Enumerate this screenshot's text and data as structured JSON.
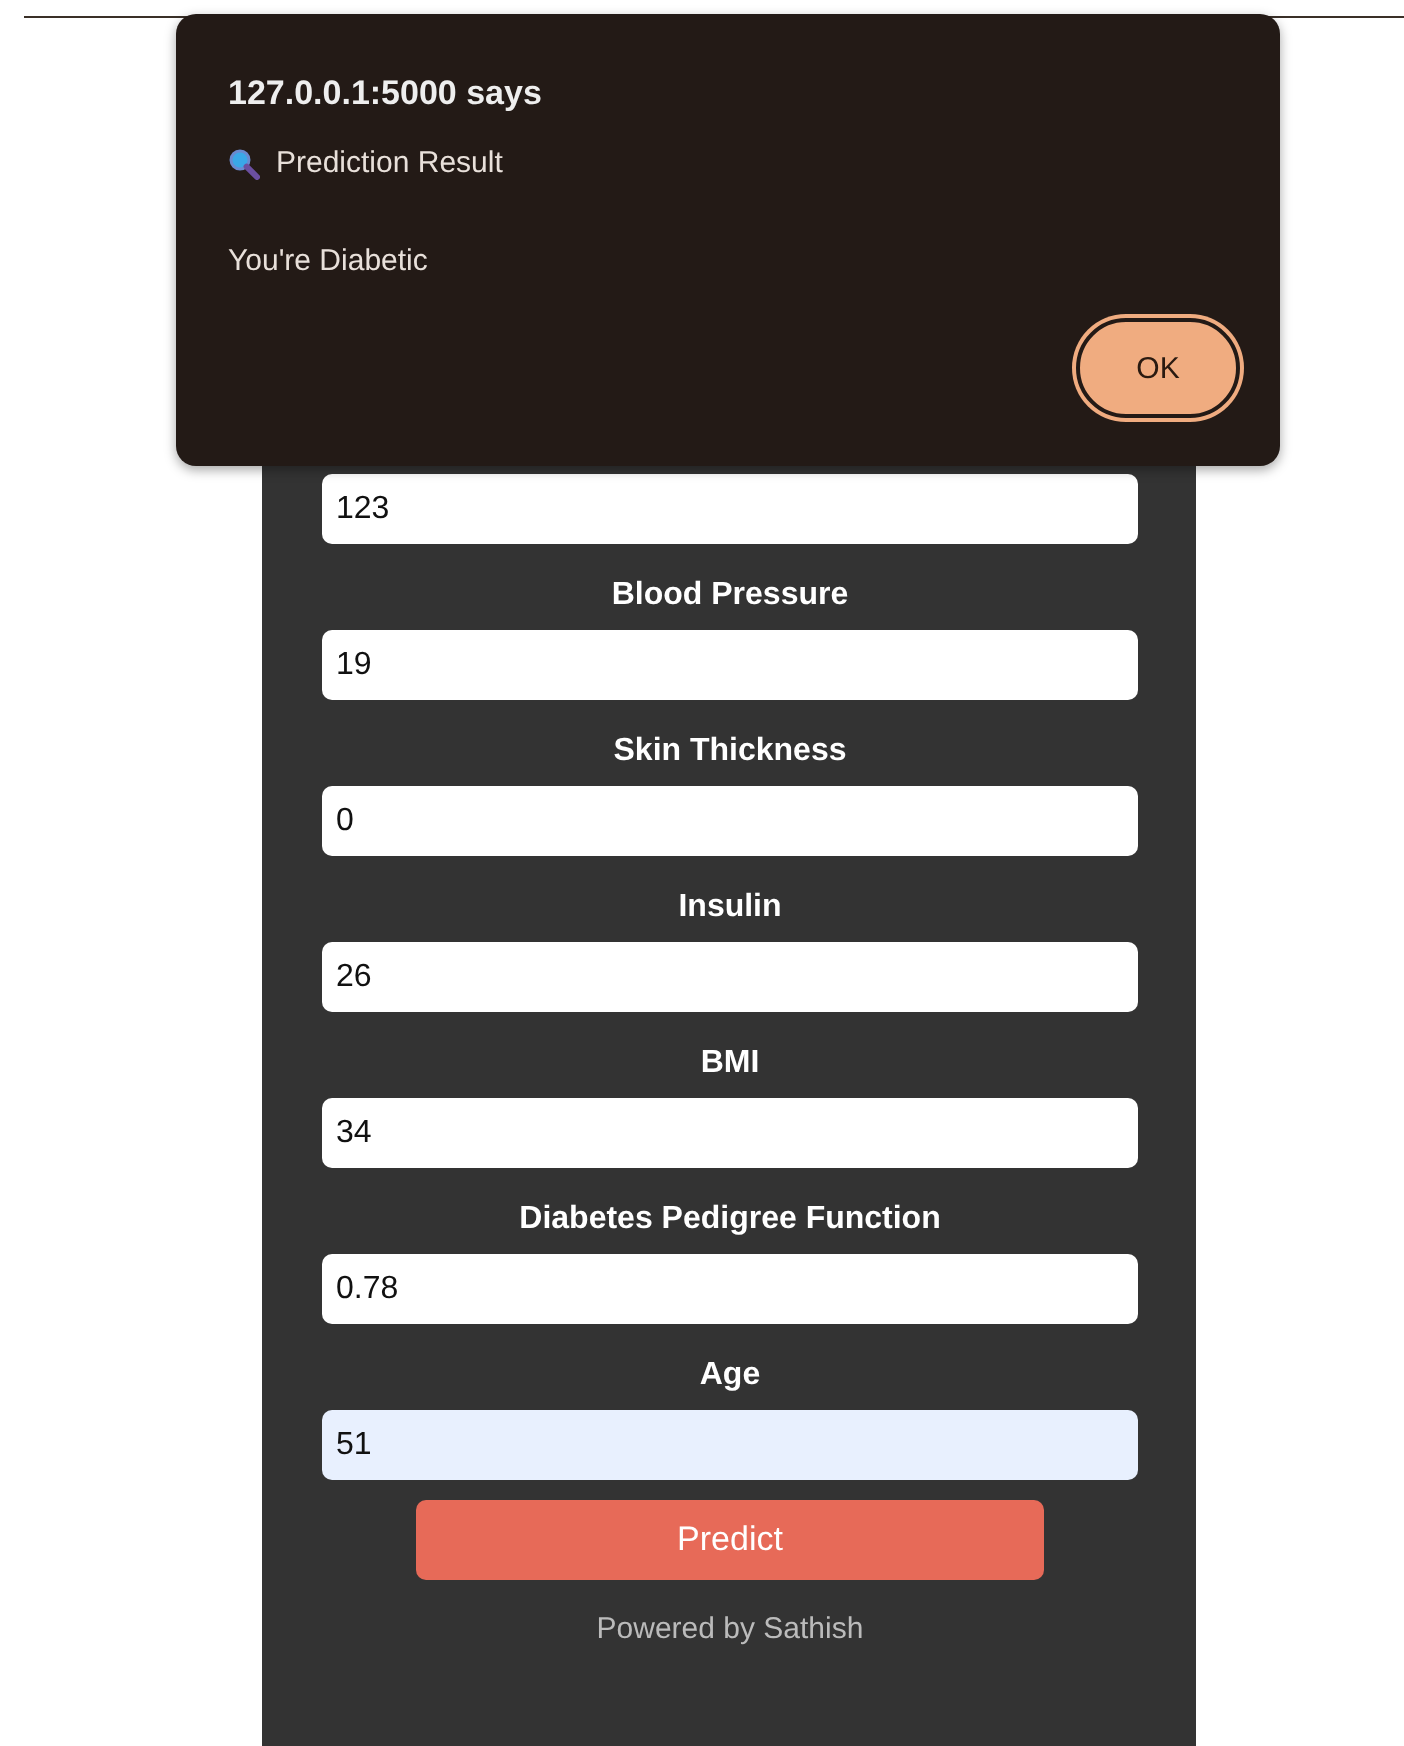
{
  "dialog": {
    "title": "127.0.0.1:5000 says",
    "heading": "Prediction Result",
    "message": "You're Diabetic",
    "button": "OK"
  },
  "fields": [
    {
      "value": "123",
      "autofilled": false
    },
    {
      "label": "Blood Pressure",
      "value": "19",
      "autofilled": false
    },
    {
      "label": "Skin Thickness",
      "value": "0",
      "autofilled": false
    },
    {
      "label": "Insulin",
      "value": "26",
      "autofilled": false
    },
    {
      "label": "BMI",
      "value": "34",
      "autofilled": false
    },
    {
      "label": "Diabetes Pedigree Function",
      "value": "0.78",
      "autofilled": false
    },
    {
      "label": "Age",
      "value": "51",
      "autofilled": true
    }
  ],
  "predict_button": "Predict",
  "footer": "Powered by Sathish"
}
